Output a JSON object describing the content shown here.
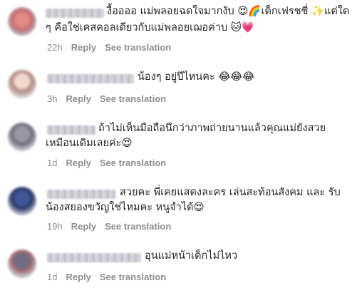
{
  "comments": [
    {
      "line1": "งื้ออออ แม่พลอยฉดใจมากงับ 😍🌈เด็กเฟรชชี่ ✨แต่ใด",
      "line2": "ๆ คือใช่เคสคอลเดียวกับแม่พลอยเฌอค่าบ 🐱💗",
      "time": "22h",
      "reply": "Reply",
      "translate": "See translation"
    },
    {
      "line1": "น้องๆ อยู่ปีไหนคะ 😂😂😂",
      "line2": "",
      "time": "3h",
      "reply": "Reply",
      "translate": "See translation"
    },
    {
      "line1": "ถ้าไม่เห็นมือถือนึกว่าภาพถ่ายนานแล้วคุณแม่ยังสวย",
      "line2": "เหมือนเดิมเลยค่ะ😍",
      "time": "1d",
      "reply": "Reply",
      "translate": "See translation"
    },
    {
      "line1": "สวยคะ พี่เคยแสดงละคร เล่นสะท้อนสังคม และ รับ",
      "line2": "น้องสยองขวัญใช่ไหมคะ หนูจำได้😍",
      "time": "19h",
      "reply": "Reply",
      "translate": "See translation"
    },
    {
      "line1": "อุนแม่หน้าเด็กไม่ไหว",
      "line2": "",
      "time": "1d",
      "reply": "Reply",
      "translate": "See translation"
    }
  ]
}
